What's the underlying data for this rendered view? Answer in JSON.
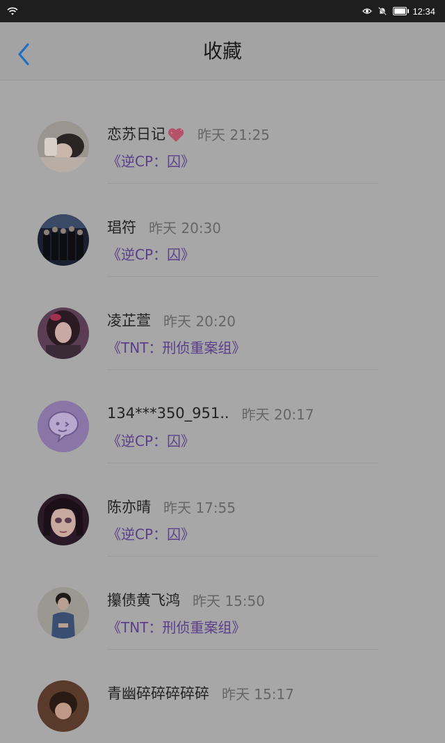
{
  "status": {
    "time": "12:34"
  },
  "header": {
    "title": "收藏"
  },
  "items": [
    {
      "name": "恋苏日记",
      "time": "昨天 21:25",
      "book": "《逆CP：囚》",
      "emoji": "heart"
    },
    {
      "name": "琩符",
      "time": "昨天 20:30",
      "book": "《逆CP：囚》"
    },
    {
      "name": "凌芷萱",
      "time": "昨天 20:20",
      "book": "《TNT：刑侦重案组》"
    },
    {
      "name": "134***350_951..",
      "time": "昨天 20:17",
      "book": "《逆CP：囚》"
    },
    {
      "name": "陈亦晴",
      "time": "昨天 17:55",
      "book": "《逆CP：囚》"
    },
    {
      "name": "攥债黄飞鸿",
      "time": "昨天 15:50",
      "book": "《TNT：刑侦重案组》"
    },
    {
      "name": "青幽碎碎碎碎碎",
      "time": "昨天 15:17",
      "book": ""
    }
  ],
  "colors": {
    "accent": "#1e6fc2",
    "book_link": "#5b3e8a"
  }
}
